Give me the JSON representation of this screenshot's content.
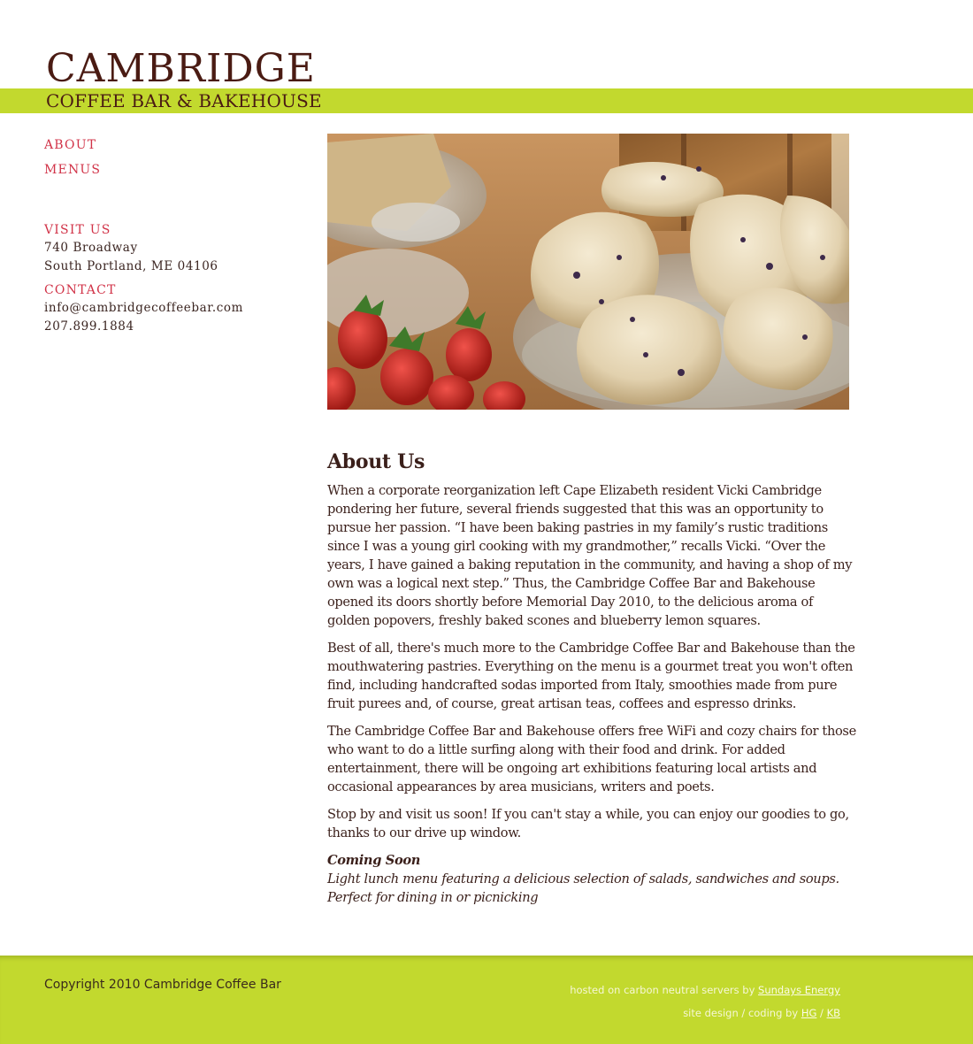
{
  "header": {
    "brand_main": "CAMBRIDGE",
    "brand_sub": "COFFEE BAR & BAKEHOUSE"
  },
  "nav": {
    "items": [
      {
        "label": "ABOUT"
      },
      {
        "label": "MENUS"
      }
    ]
  },
  "visit": {
    "heading": "VISIT US",
    "address_line1": "740 Broadway",
    "address_line2": "South Portland, ME 04106"
  },
  "contact": {
    "heading": "CONTACT",
    "email": "info@cambridgecoffeebar.com",
    "phone": "207.899.1884"
  },
  "main": {
    "title": "About Us",
    "paragraphs": [
      "When a corporate reorganization left Cape Elizabeth resident Vicki Cambridge pondering her future, several friends suggested that this was an opportunity to pursue her passion. “I have been baking pastries in my family’s rustic traditions since I was a young girl cooking with my grandmother,” recalls Vicki. “Over the years, I have gained a baking reputation in the community, and having a shop of my own was a logical next step.” Thus, the Cambridge Coffee Bar and Bakehouse opened its doors shortly before Memorial Day 2010, to the delicious aroma of golden popovers, freshly baked scones and blueberry lemon squares.",
      "Best of all, there's much more to the Cambridge Coffee Bar and Bakehouse than the mouthwatering pastries. Everything on the menu is a gourmet treat you won't often find, including handcrafted sodas imported from Italy, smoothies made from pure fruit purees and, of course, great artisan teas, coffees and espresso drinks.",
      "The Cambridge Coffee Bar and Bakehouse offers free WiFi and cozy chairs for those who want to do a little surfing along with their food and drink. For added entertainment, there will be ongoing art exhibitions featuring local artists and occasional appearances by area musicians, writers and poets.",
      "Stop by and visit us soon! If you can't stay a while, you can enjoy our goodies to go, thanks to our drive up window."
    ],
    "coming_soon_title": "Coming Soon",
    "coming_soon_line1": "Light lunch menu featuring a delicious selection of salads, sandwiches and soups.",
    "coming_soon_line2": "Perfect for dining in or picnicking"
  },
  "footer": {
    "copyright": "Copyright 2010 Cambridge Coffee Bar",
    "hosted_prefix": "hosted on carbon neutral servers by ",
    "hosted_link": "Sundays Energy",
    "design_prefix": "site design / coding by ",
    "design_link1": "HG",
    "design_sep": " / ",
    "design_link2": "KB"
  },
  "colors": {
    "accent_green": "#c2d92e",
    "brand_brown": "#4a1b13",
    "nav_red": "#d13348"
  }
}
